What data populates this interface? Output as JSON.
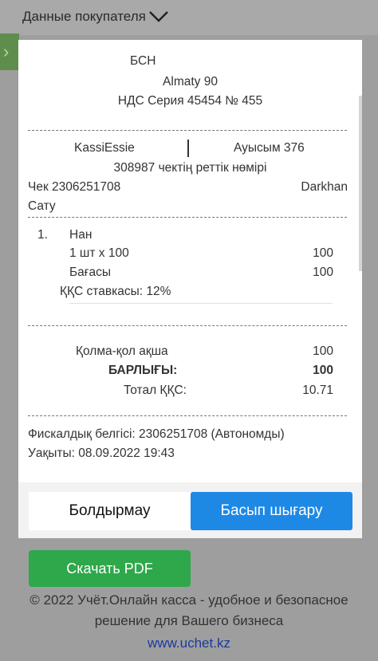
{
  "background": {
    "header_label": "Данные покупателя",
    "footer_line1": "© 2022 Учёт.Онлайн касса - удобное и безопасное",
    "footer_line2": "решение для Вашего бизнеса",
    "footer_link": "www.uchet.kz",
    "pdf_button": "Скачать PDF"
  },
  "receipt": {
    "org": "БСН",
    "address": "Almaty 90",
    "vat": "НДС Серия 45454 № 455",
    "cashier": "KassiEssie",
    "shift": "Ауысым 376",
    "sequence": "308987 чектің реттік нөмірі",
    "check_no": "Чек 2306251708",
    "store": "Darkhan",
    "op_type": "Сату",
    "items": [
      {
        "index": "1.",
        "name": "Нан",
        "qty_price": "1 шт x 100",
        "qty_total": "100",
        "price_label": "Бағасы",
        "price_value": "100",
        "vat_rate": "ҚҚС ставкасы: 12%"
      }
    ],
    "cash_label": "Қолма-қол ақша",
    "cash_value": "100",
    "total_label": "БАРЛЫҒЫ:",
    "total_value": "100",
    "vat_total_label": "Тотал ҚҚС:",
    "vat_total_value": "10.71",
    "fiscal": "Фискалдық белгісі: 2306251708 (Автономды)",
    "time": "Уақыты: 08.09.2022 19:43"
  },
  "actions": {
    "cancel": "Болдырмау",
    "print": "Басып шығару"
  },
  "colors": {
    "print_button": "#1e88e5",
    "pdf_button": "#2ea84a",
    "link": "#1a3a9c"
  }
}
